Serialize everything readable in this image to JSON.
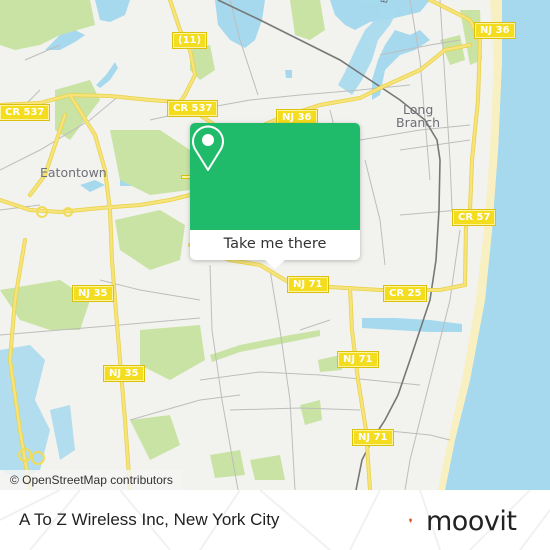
{
  "map": {
    "attribution": "© OpenStreetMap contributors",
    "colors": {
      "land": "#f2f2ee",
      "water": "#a6d9ee",
      "park": "#c9e3a4",
      "major_road": "#f4e06a",
      "minor_road": "#bdbdbd",
      "rail": "#777777",
      "beach": "#f8f0c0"
    },
    "place_labels": {
      "eatontown": "Eatontown",
      "long": "Long",
      "branch": "Branch",
      "branch_river": "Branch"
    },
    "road_shields": {
      "r11": "(11)",
      "cr537_left": "CR 537",
      "cr537_mid": "CR 537",
      "nj36_top": "NJ 36",
      "nj36_center": "NJ 36",
      "nj35_a": "NJ 35",
      "nj35_b": "NJ 35",
      "nj71_a": "NJ 71",
      "nj71_b": "NJ 71",
      "nj71_c": "NJ 71",
      "cr25": "CR 25",
      "cr57": "CR 57",
      "hidden_left": ""
    }
  },
  "popup": {
    "icon": "location-pin-icon",
    "button_label": "Take me there",
    "color": "#1fbb6b"
  },
  "footer": {
    "title": "A To Z Wireless Inc, New York City",
    "logo_text": "moovit",
    "logo_icon": "moovit-smile-pin-icon",
    "logo_color": "#f05a28"
  }
}
